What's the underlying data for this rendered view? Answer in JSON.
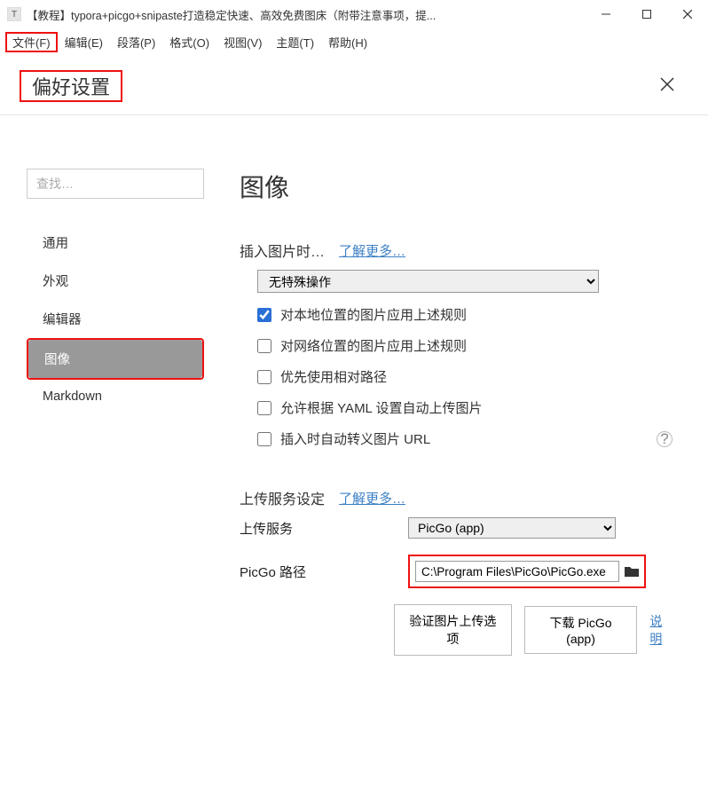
{
  "titlebar": {
    "icon": "T",
    "title": "【教程】typora+picgo+snipaste打造稳定快速、高效免费图床（附带注意事项，提..."
  },
  "menubar": {
    "file": "文件(F)",
    "edit": "编辑(E)",
    "paragraph": "段落(P)",
    "format": "格式(O)",
    "view": "视图(V)",
    "theme": "主题(T)",
    "help": "帮助(H)"
  },
  "pref": {
    "title": "偏好设置"
  },
  "search": {
    "placeholder": "查找…"
  },
  "sidebar": {
    "items": [
      {
        "label": "通用"
      },
      {
        "label": "外观"
      },
      {
        "label": "编辑器"
      },
      {
        "label": "图像"
      },
      {
        "label": "Markdown"
      }
    ]
  },
  "content": {
    "heading": "图像",
    "insert_label": "插入图片时…",
    "learn_more": "了解更多…",
    "insert_action": "无特殊操作",
    "chk1": "对本地位置的图片应用上述规则",
    "chk2": "对网络位置的图片应用上述规则",
    "chk3": "优先使用相对路径",
    "chk4": "允许根据 YAML 设置自动上传图片",
    "chk5": "插入时自动转义图片 URL",
    "upload_heading": "上传服务设定",
    "upload_learn": "了解更多…",
    "upload_service_label": "上传服务",
    "upload_service_value": "PicGo (app)",
    "picgo_label": "PicGo 路径",
    "picgo_path": "C:\\Program Files\\PicGo\\PicGo.exe",
    "btn_verify": "验证图片上传选项",
    "btn_download": "下载 PicGo (app)",
    "link_desc": "说明"
  }
}
